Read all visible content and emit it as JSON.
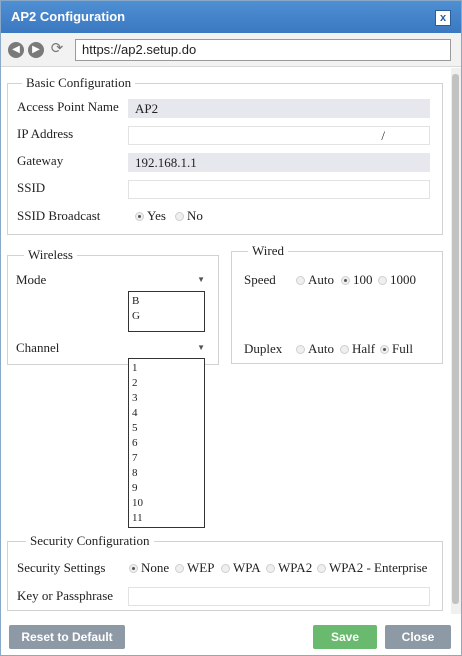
{
  "window": {
    "title": "AP2 Configuration",
    "close_symbol": "x"
  },
  "browser": {
    "url": "https://ap2.setup.do"
  },
  "basic": {
    "legend": "Basic Configuration",
    "ap_name_label": "Access Point Name",
    "ap_name_value": "AP2",
    "ip_label": "IP Address",
    "ip_value": "/",
    "gateway_label": "Gateway",
    "gateway_value": "192.168.1.1",
    "ssid_label": "SSID",
    "ssid_value": "",
    "ssid_broadcast_label": "SSID Broadcast",
    "ssid_broadcast_options": [
      "Yes",
      "No"
    ],
    "ssid_broadcast_selected": "Yes"
  },
  "wireless": {
    "legend": "Wireless",
    "mode_label": "Mode",
    "mode_options": [
      "B",
      "G"
    ],
    "channel_label": "Channel",
    "channel_options": [
      "1",
      "2",
      "3",
      "4",
      "5",
      "6",
      "7",
      "8",
      "9",
      "10",
      "11"
    ]
  },
  "wired": {
    "legend": "Wired",
    "speed_label": "Speed",
    "speed_options": [
      "Auto",
      "100",
      "1000"
    ],
    "speed_selected": "100",
    "duplex_label": "Duplex",
    "duplex_options": [
      "Auto",
      "Half",
      "Full"
    ],
    "duplex_selected": "Full"
  },
  "security": {
    "legend": "Security Configuration",
    "settings_label": "Security Settings",
    "settings_options": [
      "None",
      "WEP",
      "WPA",
      "WPA2",
      "WPA2 - Enterprise"
    ],
    "settings_selected": "None",
    "key_label": "Key or Passphrase",
    "key_value": ""
  },
  "buttons": {
    "reset": "Reset to Default",
    "save": "Save",
    "close": "Close"
  },
  "colors": {
    "titlebar": "#3a78c0",
    "save": "#69b96e",
    "neutral_button": "#8e99a6"
  },
  "icons": {
    "back": "back-arrow-icon",
    "forward": "forward-arrow-icon",
    "refresh": "refresh-icon",
    "close": "close-icon"
  }
}
